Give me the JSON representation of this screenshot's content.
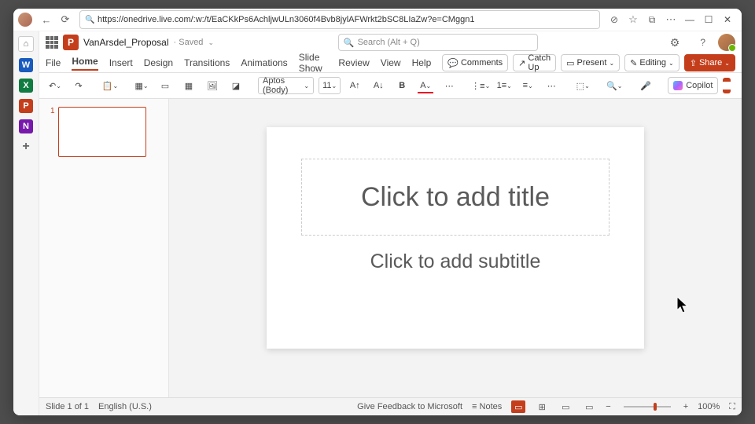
{
  "browser": {
    "url": "https://onedrive.live.com/:w:/t/EaCKkPs6AchljwULn3060f4Bvb8jylAFWrkt2bSC8LIaZw?e=CMggn1"
  },
  "header": {
    "doc_name": "VanArsdel_Proposal",
    "saved": "· Saved",
    "search_ph": "Search (Alt + Q)"
  },
  "tabs": {
    "file": "File",
    "home": "Home",
    "insert": "Insert",
    "design": "Design",
    "transitions": "Transitions",
    "animations": "Animations",
    "slideshow": "Slide Show",
    "review": "Review",
    "view": "View",
    "help": "Help"
  },
  "tab_buttons": {
    "comments": "Comments",
    "catchup": "Catch Up",
    "present": "Present",
    "editing": "Editing",
    "share": "Share"
  },
  "ribbon": {
    "font": "Aptos (Body)",
    "size": "11",
    "copilot": "Copilot"
  },
  "slide": {
    "title_ph": "Click to add title",
    "subtitle_ph": "Click to add subtitle"
  },
  "thumbs": {
    "n1": "1"
  },
  "status": {
    "slide": "Slide 1 of 1",
    "lang": "English (U.S.)",
    "feedback": "Give Feedback to Microsoft",
    "notes": "Notes",
    "zoom": "100%"
  }
}
